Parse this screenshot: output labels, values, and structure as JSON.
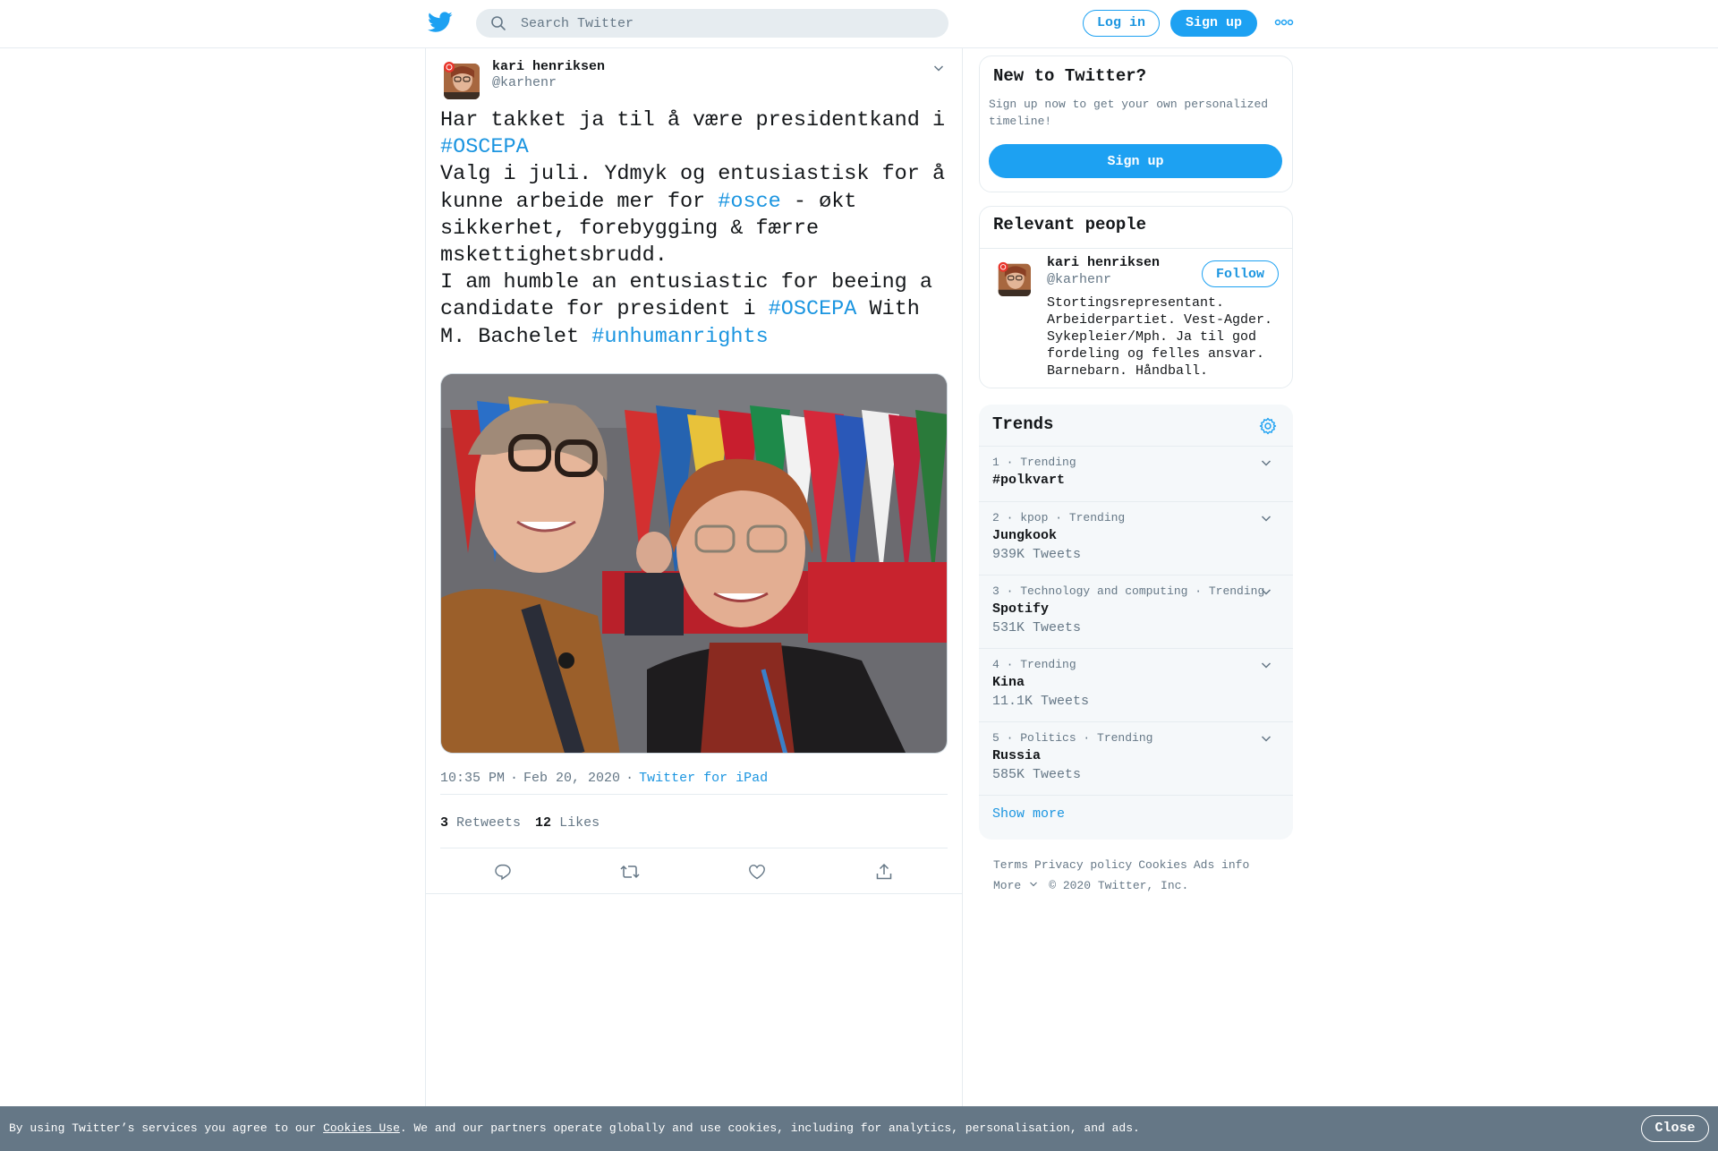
{
  "header": {
    "search_placeholder": "Search Twitter",
    "login_label": "Log in",
    "signup_label": "Sign up"
  },
  "tweet": {
    "author_name": "kari henriksen",
    "author_handle": "@karhenr",
    "text_parts": {
      "p1": "Har takket ja til å være presidentkand i ",
      "tag1": "#OSCEPA",
      "p2": "\nValg i juli. Ydmyk og entusiastisk for å kunne arbeide mer for ",
      "tag2": "#osce",
      "p3": " - økt sikkerhet, forebygging & færre mskettighetsbrudd.\nI am humble an entusiastic for beeing a candidate for president i ",
      "tag3": "#OSCEPA",
      "p4": " With M. Bachelet ",
      "tag4": "#unhumanrights"
    },
    "time": "10:35 PM",
    "date": "Feb 20, 2020",
    "source": "Twitter for iPad",
    "retweets_count": "3",
    "retweets_label": "Retweets",
    "likes_count": "12",
    "likes_label": "Likes"
  },
  "sidebar": {
    "new_title": "New to Twitter?",
    "new_desc": "Sign up now to get your own personalized timeline!",
    "new_signup": "Sign up",
    "people_title": "Relevant people",
    "person": {
      "name": "kari henriksen",
      "handle": "@karhenr",
      "follow_label": "Follow",
      "bio": "Stortingsrepresentant. Arbeiderpartiet. Vest-Agder. Sykepleier/Mph. Ja til god fordeling og felles ansvar. Barnebarn. Håndball."
    },
    "trends_title": "Trends",
    "trends": [
      {
        "context": "1 · Trending",
        "name": "#polkvart",
        "count": ""
      },
      {
        "context": "2 · kpop · Trending",
        "name": "Jungkook",
        "count": "939K Tweets"
      },
      {
        "context": "3 · Technology and computing · Trending",
        "name": "Spotify",
        "count": "531K Tweets"
      },
      {
        "context": "4 · Trending",
        "name": "Kina",
        "count": "11.1K Tweets"
      },
      {
        "context": "5 · Politics · Trending",
        "name": "Russia",
        "count": "585K Tweets"
      }
    ],
    "show_more": "Show more"
  },
  "footer": {
    "links": [
      "Terms",
      "Privacy policy",
      "Cookies",
      "Ads info"
    ],
    "more": "More",
    "copyright": "© 2020 Twitter, Inc."
  },
  "cookie_bar": {
    "text_before": "By using Twitter’s services you agree to our ",
    "link": "Cookies Use",
    "text_after": ". We and our partners operate globally and use cookies, including for analytics, personalisation, and ads.",
    "close_label": "Close"
  },
  "colors": {
    "brand_blue": "#1da1f2",
    "link_blue": "#1b95e0",
    "muted": "#657786",
    "border": "#e6ecf0"
  },
  "icons": [
    "twitter-logo-icon",
    "search-icon",
    "more-dots-icon",
    "chevron-down-icon",
    "reply-icon",
    "retweet-icon",
    "like-icon",
    "share-icon",
    "settings-gear-icon"
  ]
}
